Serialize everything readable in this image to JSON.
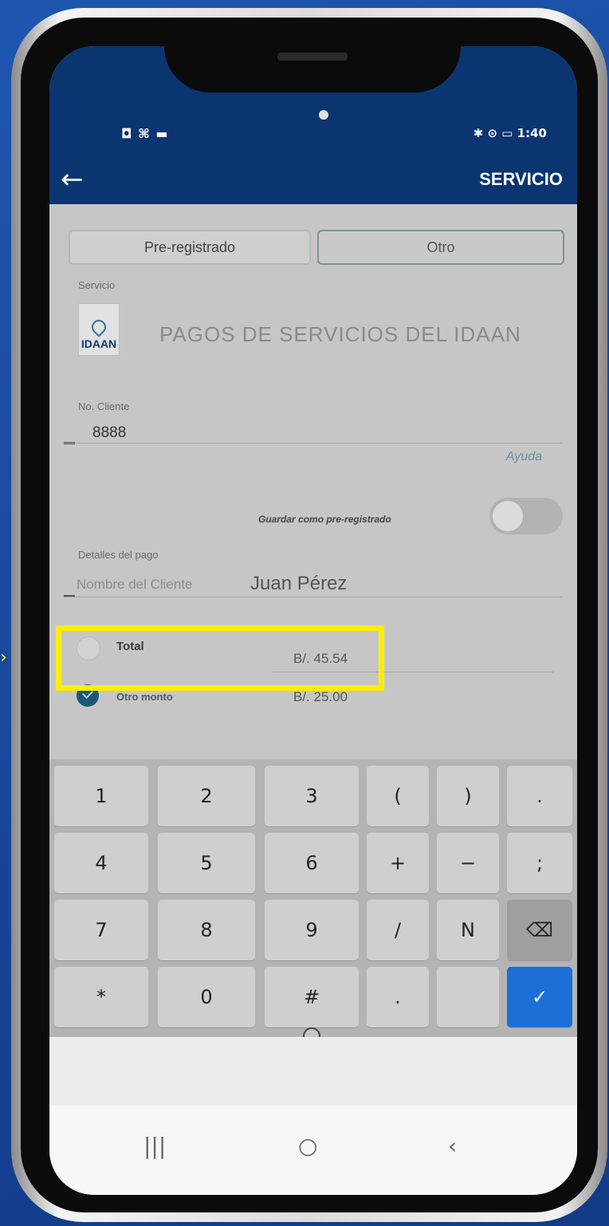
{
  "status_bar": {
    "left_icons": "◘ ⌘ ▬",
    "right_icons": "✱ ⊙ ▭ 1:40"
  },
  "app_bar": {
    "back_icon": "←",
    "title": "SERVICIO"
  },
  "segments": {
    "pre_registered": "Pre-registrado",
    "other": "Otro",
    "active": "Otro"
  },
  "service": {
    "section_label": "Servicio",
    "logo_text": "IDAAN",
    "name": "PAGOS DE SERVICIOS DEL IDAAN"
  },
  "client": {
    "label": "No. Cliente",
    "value": "8888",
    "help_link": "Ayuda"
  },
  "save_toggle": {
    "label": "Guardar como pre-registrado",
    "on": false
  },
  "payment_details": {
    "label": "Detalles del pago",
    "client_name_placeholder": "Nombre del Cliente",
    "client_name_value": "Juan Pérez"
  },
  "amount_options": [
    {
      "label": "Total",
      "amount": "B/. 45.54",
      "selected": false
    },
    {
      "label": "Otro monto",
      "amount": "B/. 25.00",
      "selected": true
    }
  ],
  "highlight_color": "#ffee00",
  "keyboard": {
    "rows": [
      [
        "1",
        "2",
        "3",
        "(",
        ")",
        "."
      ],
      [
        "4",
        "5",
        "6",
        "+",
        "−",
        ";"
      ],
      [
        "7",
        "8",
        "9",
        "/",
        "N",
        "⌫"
      ],
      [
        "*",
        "0",
        "#",
        ".",
        "",
        "✓"
      ]
    ]
  },
  "nav_bar": {
    "recents_icon": "|||",
    "home_icon": "○",
    "back_icon": "‹"
  },
  "colors": {
    "app_bar": "#0b3570",
    "done_key": "#1c6fd6",
    "radio_selected": "#1b5878"
  }
}
